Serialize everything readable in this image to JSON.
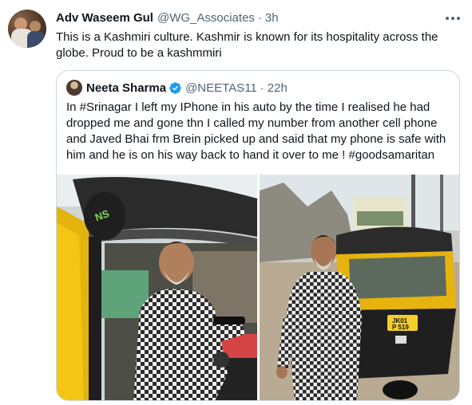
{
  "tweet": {
    "author_name": "Adv Waseem Gul",
    "handle": "@WG_Associates",
    "separator": "·",
    "time": "3h",
    "text": "This is a Kashmiri culture. Kashmir is known for its hospitality across the globe. Proud to be a kashmmiri",
    "more_icon": "more-horizontal-icon"
  },
  "quoted_tweet": {
    "author_name": "Neeta Sharma",
    "handle": "@NEETAS11",
    "separator": "·",
    "time": "22h",
    "verified": true,
    "verified_icon": "verified-badge-icon",
    "text": "In #Srinagar I left my IPhone in his auto by the time I realised he had dropped me and gone thn I called my number from another cell phone and Javed Bhai frm Brein picked up and said that my phone is safe with him and he is on his way back to hand it over to me ! #goodsamaritan",
    "photos": [
      {
        "sign_text": "NS"
      },
      {
        "plate_line1": "JK01",
        "plate_line2": "P 519"
      }
    ]
  },
  "colors": {
    "text_primary": "#0f1419",
    "text_secondary": "#536471",
    "border": "#cfd9de",
    "verified_blue": "#1d9bf0",
    "auto_yellow": "#f1c40f"
  }
}
